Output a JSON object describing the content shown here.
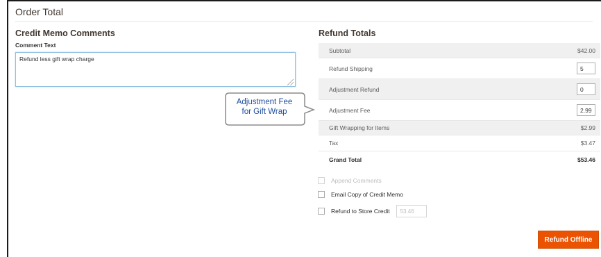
{
  "section": {
    "title": "Order Total"
  },
  "comments": {
    "heading": "Credit Memo Comments",
    "field_label": "Comment Text",
    "value": "Refund less gift wrap charge"
  },
  "callout": {
    "line1": "Adjustment Fee",
    "line2": "for Gift Wrap"
  },
  "totals": {
    "heading": "Refund Totals",
    "subtotal": {
      "label": "Subtotal",
      "value": "$42.00"
    },
    "refund_shipping": {
      "label": "Refund Shipping",
      "value": "5"
    },
    "adjustment_refund": {
      "label": "Adjustment Refund",
      "value": "0"
    },
    "adjustment_fee": {
      "label": "Adjustment Fee",
      "value": "2.99"
    },
    "gift_wrapping": {
      "label": "Gift Wrapping for Items",
      "value": "$2.99"
    },
    "tax": {
      "label": "Tax",
      "value": "$3.47"
    },
    "grand_total": {
      "label": "Grand Total",
      "value": "$53.46"
    }
  },
  "options": {
    "append_comments": "Append Comments",
    "email_copy": "Email Copy of Credit Memo",
    "refund_store_credit": "Refund to Store Credit",
    "store_credit_value": "53.46"
  },
  "actions": {
    "refund_offline": "Refund Offline"
  },
  "colors": {
    "accent": "#eb5202",
    "callout_text": "#1f4e9e",
    "focus_border": "#8fbfe0"
  }
}
